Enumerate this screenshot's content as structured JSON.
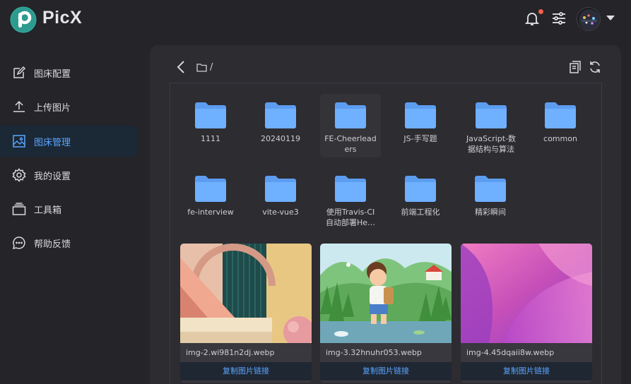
{
  "app": {
    "name": "PicX"
  },
  "header": {
    "bell_icon": "bell-icon",
    "settings_icon": "tune-icon",
    "avatar_icon": "avatar"
  },
  "sidebar": {
    "items": [
      {
        "label": "图床配置",
        "icon": "edit-icon",
        "active": false
      },
      {
        "label": "上传图片",
        "icon": "upload-icon",
        "active": false
      },
      {
        "label": "图床管理",
        "icon": "image-icon",
        "active": true
      },
      {
        "label": "我的设置",
        "icon": "gear-icon",
        "active": false
      },
      {
        "label": "工具箱",
        "icon": "toolbox-icon",
        "active": false
      },
      {
        "label": "帮助反馈",
        "icon": "chat-icon",
        "active": false
      }
    ]
  },
  "toolbar": {
    "path": "/"
  },
  "folders": [
    {
      "name": "1111"
    },
    {
      "name": "20240119"
    },
    {
      "name": "FE-Cheerleaders"
    },
    {
      "name": "JS-手写题"
    },
    {
      "name": "JavaScript-数据结构与算法"
    },
    {
      "name": "common"
    },
    {
      "name": "fe-interview"
    },
    {
      "name": "vite-vue3"
    },
    {
      "name": "使用Travis-CI自动部署He…"
    },
    {
      "name": "前端工程化"
    },
    {
      "name": "精彩瞬间"
    }
  ],
  "images": [
    {
      "name": "img-2.wi981n2dj.webp",
      "button": "复制图片链接"
    },
    {
      "name": "img-3.32hnuhr053.webp",
      "button": "复制图片链接"
    },
    {
      "name": "img-4.45dqaii8w.webp",
      "button": "复制图片链接"
    }
  ],
  "colors": {
    "accent": "#5aa5ff",
    "folder": "#6aa8ff",
    "background": "#242429",
    "panel": "#2c2c31"
  }
}
